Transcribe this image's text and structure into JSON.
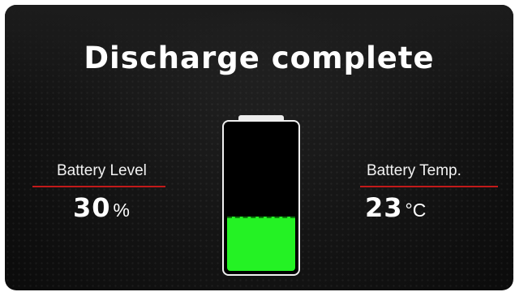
{
  "screen": {
    "title": "Discharge complete"
  },
  "battery_level": {
    "label": "Battery Level",
    "value": "30",
    "unit": "%"
  },
  "battery_temp": {
    "label": "Battery Temp.",
    "value": "23",
    "unit": "°C"
  },
  "battery_gauge": {
    "level": 0.36
  },
  "colors": {
    "accent_line": "#c21a1a",
    "battery_fill": "#24f224",
    "background": "#151515"
  }
}
